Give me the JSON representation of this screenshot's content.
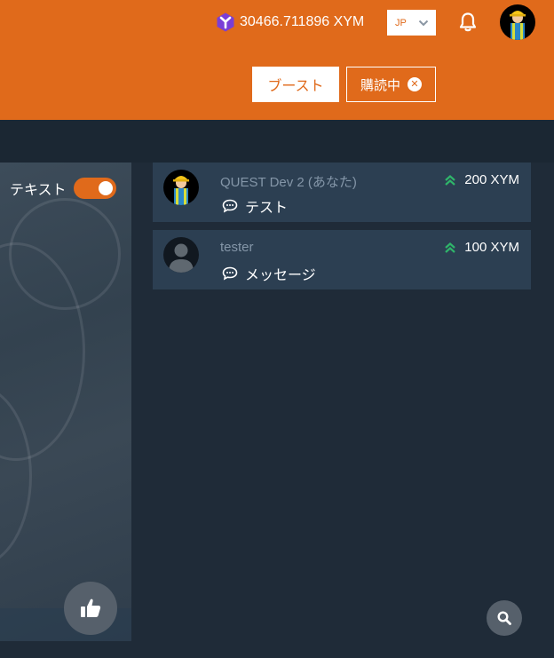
{
  "header": {
    "balance": "30466.711896 XYM",
    "language": "JP",
    "boost_label": "ブースト",
    "subscribed_label": "購読中",
    "unsubscribe_icon": "close-circle-icon",
    "colors": {
      "accent": "#e06a1b"
    }
  },
  "video": {
    "text_toggle_label": "テキスト",
    "text_toggle_on": true
  },
  "messages": [
    {
      "name": "QUEST Dev 2 (あなた)",
      "amount": "200 XYM",
      "text": "テスト",
      "avatar": "hardhat-worker-avatar"
    },
    {
      "name": "tester",
      "amount": "100 XYM",
      "text": "メッセージ",
      "avatar": "default-user-avatar"
    }
  ],
  "colors": {
    "background": "#1f2b38",
    "card": "#2c3f52",
    "boost_chevron": "#2fb56a"
  }
}
